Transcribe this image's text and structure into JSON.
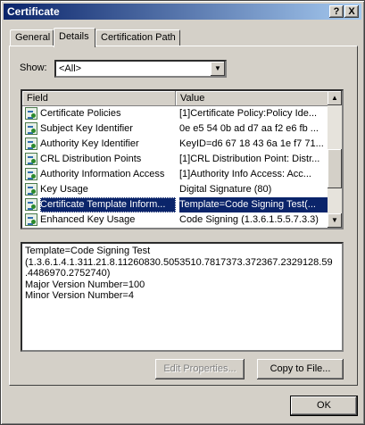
{
  "window": {
    "title": "Certificate",
    "help_btn": "?",
    "close_btn": "X"
  },
  "tabs": [
    {
      "label": "General"
    },
    {
      "label": "Details"
    },
    {
      "label": "Certification Path"
    }
  ],
  "show": {
    "label": "Show:",
    "value": "<All>"
  },
  "list": {
    "columns": {
      "field": "Field",
      "value": "Value"
    },
    "rows": [
      {
        "field": "Certificate Policies",
        "value": "[1]Certificate Policy:Policy Ide..."
      },
      {
        "field": "Subject Key Identifier",
        "value": "0e e5 54 0b ad d7 aa f2 e6 fb ..."
      },
      {
        "field": "Authority Key Identifier",
        "value": "KeyID=d6 67 18 43 6a 1e f7 71..."
      },
      {
        "field": "CRL Distribution Points",
        "value": "[1]CRL Distribution Point: Distr..."
      },
      {
        "field": "Authority Information Access",
        "value": "[1]Authority Info Access: Acc..."
      },
      {
        "field": "Key Usage",
        "value": "Digital Signature (80)"
      },
      {
        "field": "Certificate Template Inform...",
        "value": "Template=Code Signing Test(..."
      },
      {
        "field": "Enhanced Key Usage",
        "value": "Code Signing (1.3.6.1.5.5.7.3.3)"
      }
    ],
    "selected_index": 6
  },
  "detail": {
    "lines": [
      "Template=Code Signing Test",
      "(1.3.6.1.4.1.311.21.8.11260830.5053510.7817373.372367.2329128.59\n.4486970.2752740)",
      "Major Version Number=100",
      "Minor Version Number=4"
    ]
  },
  "buttons": {
    "edit": "Edit Properties...",
    "copy": "Copy to File...",
    "ok": "OK"
  }
}
